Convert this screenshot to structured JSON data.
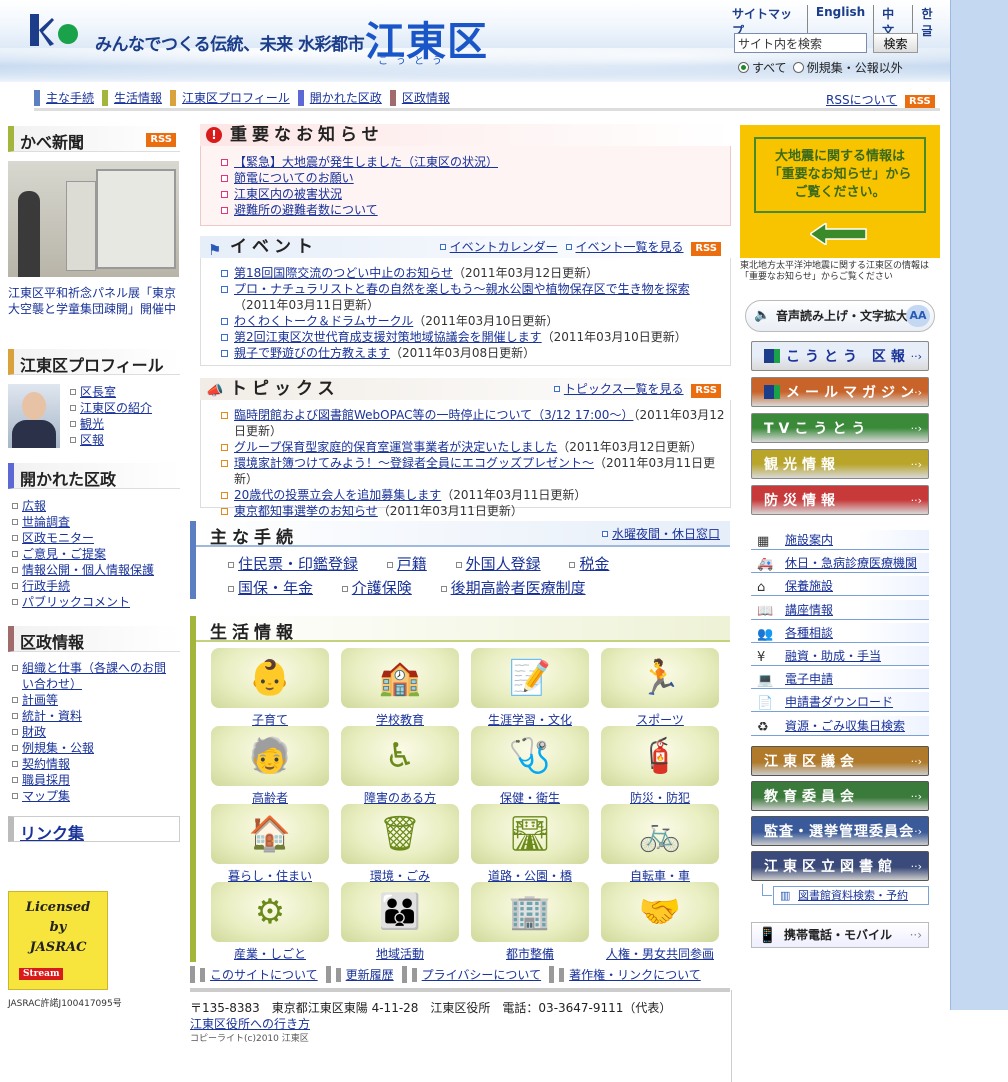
{
  "header": {
    "tagline": "みんなでつくる伝統、未来 水彩都市",
    "name": "江東区",
    "name_kana": "こうとう",
    "lang_links": [
      "サイトマップ",
      "English",
      "中文",
      "한글"
    ],
    "search_placeholder": "サイト内を検索",
    "search_button": "検索",
    "radio_all": "すべて",
    "radio_except": "例規集・公報以外"
  },
  "gnav": {
    "items": [
      "主な手続",
      "生活情報",
      "江東区プロフィール",
      "開かれた区政",
      "区政情報"
    ],
    "colors": [
      "#5c7fc2",
      "#a3b53a",
      "#d9a23c",
      "#5c69d4",
      "#a06b6b"
    ],
    "rss_about": "RSSについて",
    "rss": "RSS"
  },
  "left": {
    "kabe_title": "かべ新聞",
    "rss": "RSS",
    "kabe_caption": "江東区平和祈念パネル展「東京大空襲と学童集団疎開」開催中",
    "profile_title": "江東区プロフィール",
    "profile_links": [
      "区長室",
      "江東区の紹介",
      "観光",
      "区報"
    ],
    "open_title": "開かれた区政",
    "open_links": [
      "広報",
      "世論調査",
      "区政モニター",
      "ご意見・ご提案",
      "情報公開・個人情報保護",
      "行政手続",
      "パブリックコメント"
    ],
    "info_title": "区政情報",
    "info_links": [
      "組織と仕事（各課へのお問い合わせ）",
      "計画等",
      "統計・資料",
      "財政",
      "例規集・公報",
      "契約情報",
      "職員採用",
      "マップ集"
    ],
    "link_title": "リンク集",
    "jasrac_lines": [
      "Licensed",
      "by",
      "JASRAC"
    ],
    "jasrac_badge": "Stream",
    "jasrac_note": "JASRAC許諾J100417095号"
  },
  "important": {
    "title": "重要なお知らせ",
    "items": [
      "【緊急】大地震が発生しました（江東区の状況）",
      "節電についてのお願い",
      "江東区内の被害状況",
      "避難所の避難者数について"
    ]
  },
  "event": {
    "title": "イベント",
    "calendar": "イベントカレンダー",
    "list": "イベント一覧を見る",
    "rss": "RSS",
    "items": [
      {
        "text": "第18回国際交流のつどい中止のお知らせ",
        "date": "（2011年03月12日更新）"
      },
      {
        "text": "プロ・ナチュラリストと春の自然を楽しもう～親水公園や植物保存区で生き物を探索",
        "date": "（2011年03月11日更新）"
      },
      {
        "text": "わくわくトーク＆ドラムサークル",
        "date": "（2011年03月10日更新）"
      },
      {
        "text": "第2回江東区次世代育成支援対策地域協議会を開催します",
        "date": "（2011年03月10日更新）"
      },
      {
        "text": "親子で野遊びの仕方教えます",
        "date": "（2011年03月08日更新）"
      }
    ]
  },
  "topics": {
    "title": "トピックス",
    "list": "トピックス一覧を見る",
    "rss": "RSS",
    "items": [
      {
        "text": "臨時閉館および図書館WebOPAC等の一時停止について（3/12 17:00～）",
        "date": "（2011年03月12日更新）"
      },
      {
        "text": "グループ保育型家庭的保育室運営事業者が決定いたしました",
        "date": "（2011年03月12日更新）"
      },
      {
        "text": "環境家計簿つけてみよう！～登録者全員にエコグッズプレゼント～",
        "date": "（2011年03月11日更新）"
      },
      {
        "text": "20歳代の投票立会人を追加募集します",
        "date": "（2011年03月11日更新）"
      },
      {
        "text": "東京都知事選挙のお知らせ",
        "date": "（2011年03月11日更新）"
      }
    ]
  },
  "procedures": {
    "title": "主な手続",
    "night": "水曜夜間・休日窓口",
    "items": [
      "住民票・印鑑登録",
      "戸籍",
      "外国人登録",
      "税金",
      "国保・年金",
      "介護保険",
      "後期高齢者医療制度"
    ]
  },
  "life": {
    "title": "生活情報",
    "categories": [
      {
        "label": "子育て",
        "icon": "baby-icon",
        "glyph": "👶"
      },
      {
        "label": "学校教育",
        "icon": "school-icon",
        "glyph": "🏫"
      },
      {
        "label": "生涯学習・文化",
        "icon": "book-icon",
        "glyph": "📝"
      },
      {
        "label": "スポーツ",
        "icon": "runner-icon",
        "glyph": "🏃"
      },
      {
        "label": "高齢者",
        "icon": "elderly-icon",
        "glyph": "🧓"
      },
      {
        "label": "障害のある方",
        "icon": "wheelchair-icon",
        "glyph": "♿"
      },
      {
        "label": "保健・衛生",
        "icon": "health-icon",
        "glyph": "🩺"
      },
      {
        "label": "防災・防犯",
        "icon": "extinguisher-icon",
        "glyph": "🧯"
      },
      {
        "label": "暮らし・住まい",
        "icon": "house-icon",
        "glyph": "🏠"
      },
      {
        "label": "環境・ごみ",
        "icon": "trash-icon",
        "glyph": "🗑"
      },
      {
        "label": "道路・公園・橋",
        "icon": "road-icon",
        "glyph": "🛣"
      },
      {
        "label": "自転車・車",
        "icon": "car-icon",
        "glyph": "🚲"
      },
      {
        "label": "産業・しごと",
        "icon": "gear-icon",
        "glyph": "⚙"
      },
      {
        "label": "地域活動",
        "icon": "people-icon",
        "glyph": "👪"
      },
      {
        "label": "都市整備",
        "icon": "city-icon",
        "glyph": "🏢"
      },
      {
        "label": "人権・男女共同参画",
        "icon": "handshake-icon",
        "glyph": "🤝"
      }
    ]
  },
  "right": {
    "alert_box": "大地震に関する情報は「重要なお知らせ」からご覧ください。",
    "alert_caption": "東北地方太平洋沖地震に関する江東区の情報は「重要なお知らせ」からご覧ください",
    "voice": "音声読み上げ・文字拡大",
    "banners": [
      {
        "label": "こうとう 区報",
        "color": "#e8eef8",
        "text_color": "#1a3399"
      },
      {
        "label": "メールマガジン",
        "color": "#c8642a",
        "text_color": "#ffffff"
      },
      {
        "label": "TVこうとう",
        "color": "#3b8a3a",
        "text_color": "#ffffff"
      },
      {
        "label": "観光情報",
        "color": "#b8a52a",
        "text_color": "#ffffff"
      },
      {
        "label": "防災情報",
        "color": "#c83a3a",
        "text_color": "#ffffff"
      }
    ],
    "small_links": [
      {
        "label": "施設案内",
        "icon": "building-icon",
        "glyph": "▦"
      },
      {
        "label": "休日・急病診療医療機関",
        "icon": "ambulance-icon",
        "glyph": "🚑"
      },
      {
        "label": "保養施設",
        "icon": "lodge-icon",
        "glyph": "⌂"
      },
      {
        "label": "講座情報",
        "icon": "open-book-icon",
        "glyph": "📖"
      },
      {
        "label": "各種相談",
        "icon": "consult-icon",
        "glyph": "👥"
      },
      {
        "label": "融資・助成・手当",
        "icon": "coin-icon",
        "glyph": "¥"
      },
      {
        "label": "電子申請",
        "icon": "computer-icon",
        "glyph": "💻"
      },
      {
        "label": "申請書ダウンロード",
        "icon": "document-icon",
        "glyph": "📄"
      },
      {
        "label": "資源・ごみ収集日検索",
        "icon": "recycle-icon",
        "glyph": "♻"
      }
    ],
    "org_banners": [
      {
        "label": "江東区議会",
        "color": "#b07a2a"
      },
      {
        "label": "教育委員会",
        "color": "#3a7a3a"
      },
      {
        "label": "監査・選挙管理委員会",
        "color": "#3a5a9a"
      },
      {
        "label": "江東区立図書館",
        "color": "#3a4a7a"
      }
    ],
    "library_search": "図書館資料検索・予約",
    "mobile": "携帯電話・モバイル"
  },
  "footer": {
    "links": [
      "このサイトについて",
      "更新履歴",
      "プライバシーについて",
      "著作権・リンクについて"
    ],
    "address": "〒135-8383　東京都江東区東陽 4-11-28　江東区役所　電話：03-3647-9111（代表）",
    "access": "江東区役所への行き方",
    "copyright": "コピーライト(c)2010 江東区"
  }
}
